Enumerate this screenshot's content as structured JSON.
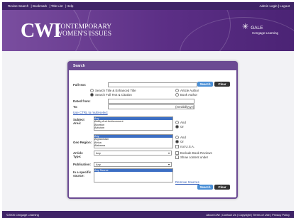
{
  "topnav": {
    "items": [
      "Revise Search",
      "Bookmark",
      "Title List",
      "Help"
    ],
    "right": "Admin Login | Logout"
  },
  "banner": {
    "logo_short": "CWI",
    "logo_line1": "CONTEMPORARY",
    "logo_line2": "WOMEN'S ISSUES",
    "publisher": "GALE",
    "publisher_sub": "Cengage Learning"
  },
  "search": {
    "panel_title": "Search",
    "full_text_label": "Full text:",
    "search_label": "Search",
    "clear_label": "Clear",
    "opt_title_enhanced": "Search Title & Enhanced Title",
    "opt_full_text": "Search Full Text & Citation",
    "opt_article_author": "Article Author",
    "opt_book_author": "Book Author",
    "dated_from_label": "Dated from:",
    "to_label": "To:",
    "date_format": "(mm/dd/yyyy)",
    "ctrl_hint": "Use CTRL to multi-select",
    "subject_label": "Subject Area:",
    "subjects": [
      "Any",
      "Ability And Achievement",
      "Abortion",
      "Activism"
    ],
    "geo_label": "Geo Region:",
    "regions": [
      "Any",
      "Afghanistan",
      "Africa",
      "Alabama"
    ],
    "and_label": "And",
    "or_label": "Or",
    "not_usa_label": "not U.S.A.",
    "article_type_label": "Article Type:",
    "article_type_value": "Any",
    "exclude_book_reviews": "Exclude Book Reviews",
    "show_content_label": "Show content under",
    "publication_label": "Publication:",
    "publication_value": "Any",
    "source_label": "In a specific source:",
    "source_value": "Any Source",
    "remove_sources": "Remove Sources"
  },
  "footer": {
    "left": "©2005 Cengage Learning",
    "right": "About CWI | Contact Us | Copyright | Terms of Use | Privacy Policy"
  },
  "colors": {
    "brand_purple": "#5c2f86",
    "search_blue": "#4a8fd6"
  }
}
